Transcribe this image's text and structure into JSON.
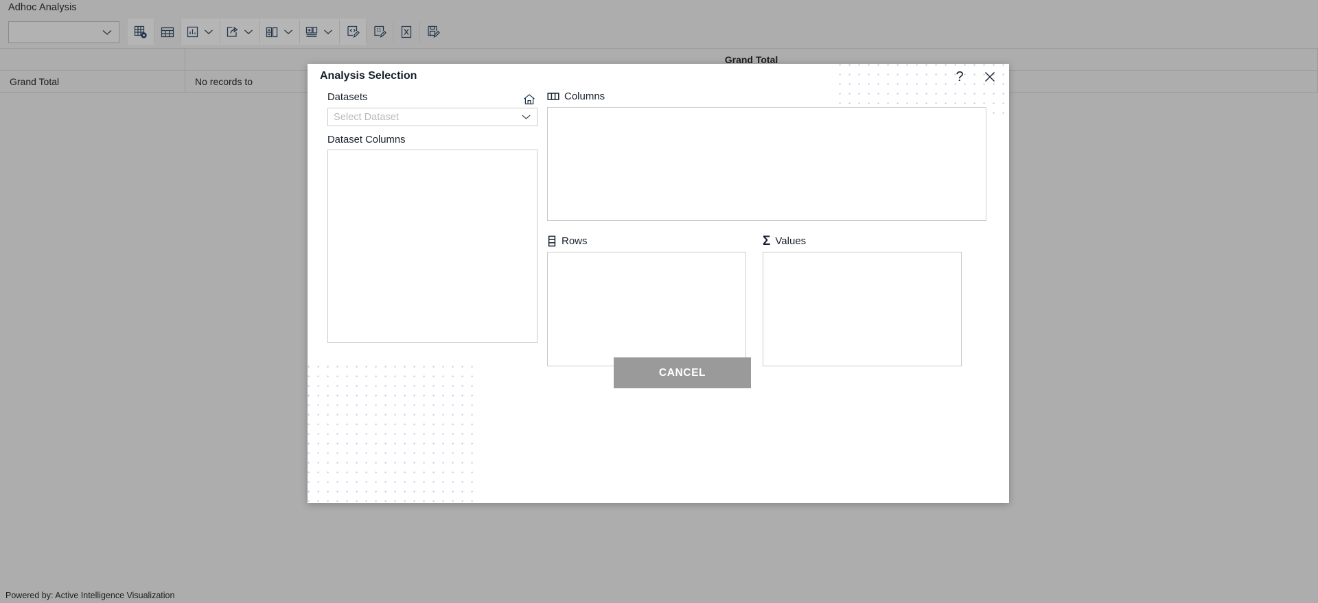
{
  "app": {
    "page_title": "Adhoc Analysis",
    "footer_credit": "Powered by: Active Intelligence Visualization"
  },
  "toolbar": {
    "dataset_select_value": "",
    "buttons": [
      {
        "name": "pivot-settings-icon",
        "tooltip": "Pivot Settings"
      },
      {
        "name": "grid-table-icon",
        "tooltip": "Grid"
      },
      {
        "name": "chart-icon",
        "tooltip": "Chart"
      },
      {
        "name": "export-share-icon",
        "tooltip": "Export"
      },
      {
        "name": "add-column-icon",
        "tooltip": "Calculated Field"
      },
      {
        "name": "add-member-icon",
        "tooltip": "Calculated Member"
      },
      {
        "name": "code-edit-icon",
        "tooltip": "Edit Expression"
      },
      {
        "name": "number-format-icon",
        "tooltip": "Number Formatting"
      },
      {
        "name": "excel-export-icon",
        "tooltip": "Export to Excel"
      },
      {
        "name": "save-report-icon",
        "tooltip": "Save Report"
      }
    ]
  },
  "pivot_grid": {
    "header": {
      "corner": "",
      "grand_total": "Grand Total"
    },
    "rows": [
      {
        "label": "Grand Total",
        "value": "No records to"
      }
    ]
  },
  "dialog": {
    "title": "Analysis Selection",
    "help_label": "?",
    "close_label": "×",
    "datasets_label": "Datasets",
    "home_icon_name": "home-icon",
    "dataset_dropdown_value": "Select Dataset",
    "dataset_columns_label": "Dataset Columns",
    "zones": {
      "columns": {
        "label": "Columns",
        "icon": "columns-icon",
        "items": []
      },
      "rows": {
        "label": "Rows",
        "icon": "rows-icon",
        "items": []
      },
      "values": {
        "label": "Values",
        "icon": "sigma-icon",
        "items": []
      }
    },
    "cancel_label": "CANCEL"
  },
  "colors": {
    "app_background": "#adadad",
    "dialog_background": "#ffffff",
    "icon_stroke": "#23354b",
    "cancel_button": "#9a9a9a",
    "deco_dot": "#9aa4cc",
    "border": "#c9c9c9"
  }
}
